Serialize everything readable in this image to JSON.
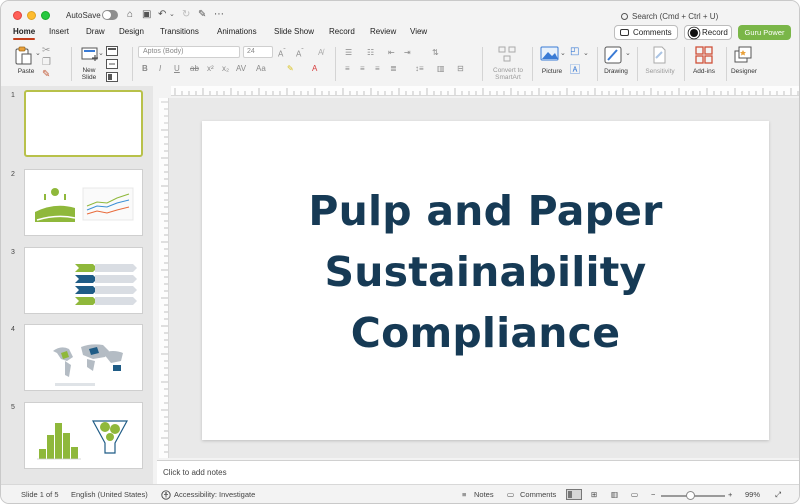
{
  "titlebar": {
    "autosave_label": "AutoSave",
    "search_placeholder": "Search (Cmd + Ctrl + U)"
  },
  "tabs": [
    "Home",
    "Insert",
    "Draw",
    "Design",
    "Transitions",
    "Animations",
    "Slide Show",
    "Record",
    "Review",
    "View"
  ],
  "active_tab": "Home",
  "header_buttons": {
    "comments": "Comments",
    "record": "Record",
    "guru": "Guru Power"
  },
  "ribbon": {
    "paste": "Paste",
    "new_slide": "New\nSlide",
    "font_name": "Aptos (Body)",
    "font_size": "24",
    "convert_smartart": "Convert to\nSmartArt",
    "picture": "Picture",
    "drawing": "Drawing",
    "sensitivity": "Sensitivity",
    "addins": "Add-ins",
    "designer": "Designer"
  },
  "slides": [
    {
      "number": "1"
    },
    {
      "number": "2"
    },
    {
      "number": "3"
    },
    {
      "number": "4"
    },
    {
      "number": "5"
    }
  ],
  "current_slide": {
    "title_lines": [
      "Pulp and Paper",
      "Sustainability",
      "Compliance"
    ]
  },
  "notes_placeholder": "Click to add notes",
  "status": {
    "slide_counter": "Slide 1 of 5",
    "language": "English (United States)",
    "accessibility": "Accessibility: Investigate",
    "notes": "Notes",
    "comments": "Comments",
    "zoom": "99%"
  },
  "colors": {
    "title": "#163a55",
    "accent_green": "#7ab648",
    "tab_underline": "#c43e1c",
    "thumb_selected": "#b8c14a"
  }
}
